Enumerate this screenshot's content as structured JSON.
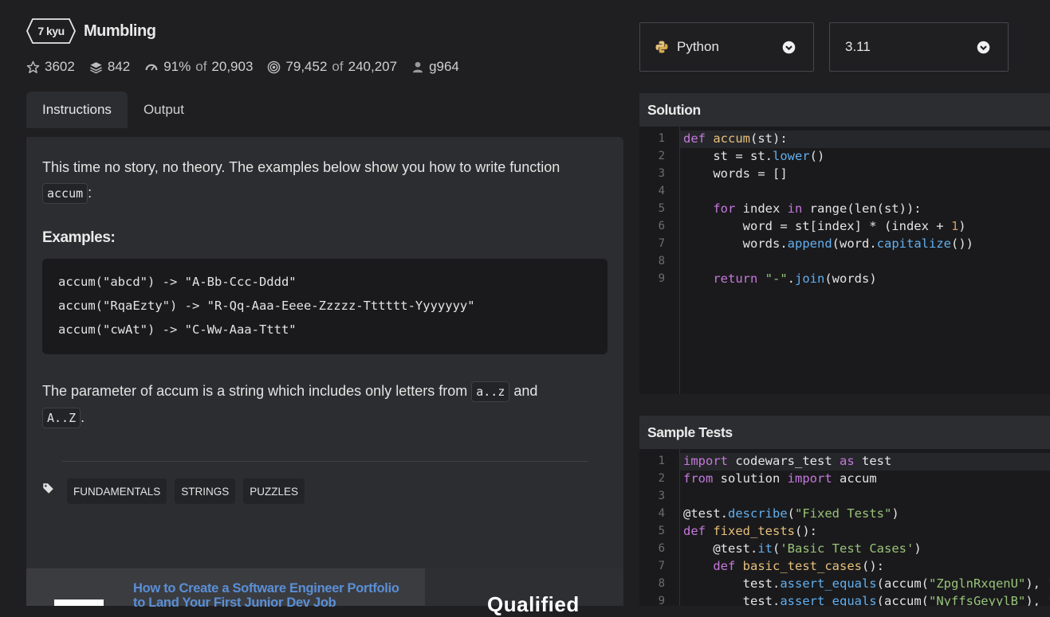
{
  "kata": {
    "rank": "7 kyu",
    "title": "Mumbling",
    "stats": {
      "stars": "3602",
      "collections": "842",
      "satisfaction_pct": "91%",
      "satisfaction_of": "of",
      "satisfaction_total": "20,903",
      "completed": "79,452",
      "completed_of": "of",
      "completed_total": "240,207",
      "author": "g964"
    }
  },
  "tabs": [
    {
      "label": "Instructions",
      "active": true
    },
    {
      "label": "Output",
      "active": false
    }
  ],
  "instructions": {
    "intro": "This time no story, no theory. The examples below show you how to write function",
    "intro_code": "accum",
    "intro_suffix": ":",
    "examples_heading": "Examples:",
    "examples": [
      "accum(\"abcd\") -> \"A-Bb-Ccc-Dddd\"",
      "accum(\"RqaEzty\") -> \"R-Qq-Aaa-Eeee-Zzzzz-Tttttt-Yyyyyyy\"",
      "accum(\"cwAt\") -> \"C-Ww-Aaa-Tttt\""
    ],
    "param_text": "The parameter of accum is a string which includes only letters from",
    "param_code1": "a..z",
    "param_and": "and",
    "param_code2": "A..Z",
    "param_suffix": "."
  },
  "tags": [
    "FUNDAMENTALS",
    "STRINGS",
    "PUZZLES"
  ],
  "ad": {
    "link_line1": "How to Create a Software Engineer Portfolio",
    "link_line2": "to Land Your First Junior Dev Job",
    "brand": "Qualified"
  },
  "language_select": {
    "value": "Python",
    "icon": "python-icon"
  },
  "version_select": {
    "value": "3.11"
  },
  "solution": {
    "header": "Solution",
    "line_numbers": [
      "1",
      "2",
      "3",
      "4",
      "5",
      "6",
      "7",
      "8",
      "9"
    ]
  },
  "sample_tests": {
    "header": "Sample Tests",
    "line_numbers": [
      "1",
      "2",
      "3",
      "4",
      "5",
      "6",
      "7",
      "8",
      "9"
    ]
  },
  "colors": {
    "background": "#1f1f21",
    "panel": "#2c2d30",
    "code_bg": "#1a1a1c",
    "keyword": "#c678dd",
    "function": "#e5c07b",
    "method": "#61afef",
    "number": "#d19a66",
    "string": "#98c379",
    "link": "#5a8fd6"
  }
}
